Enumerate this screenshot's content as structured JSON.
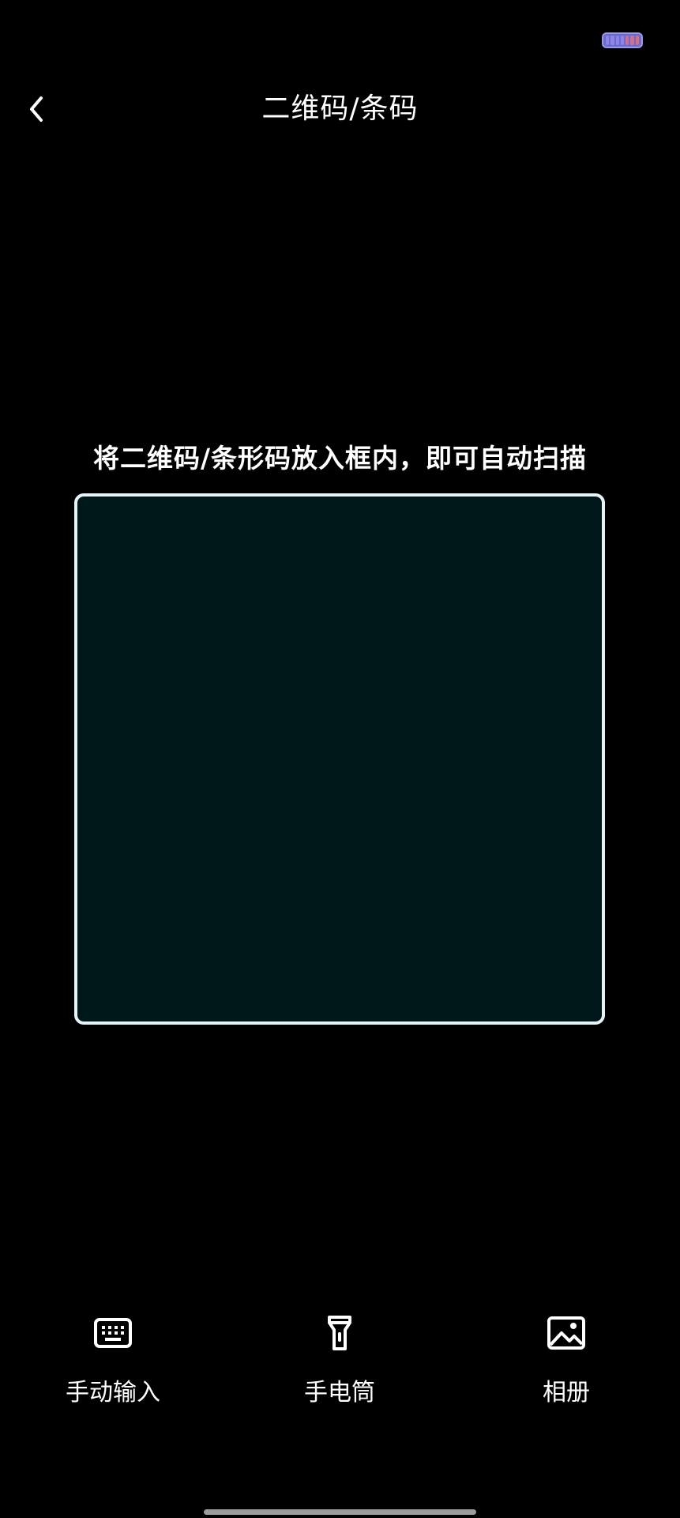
{
  "status_bar": {
    "indicator_icon": "status-indicator-icon"
  },
  "nav": {
    "back_icon": "chevron-left-icon",
    "title": "二维码/条码"
  },
  "scanner": {
    "hint": "将二维码/条形码放入框内，即可自动扫描",
    "frame_border_color": "#e4f4f8",
    "frame_fill_color": "#00171a"
  },
  "toolbar": {
    "items": [
      {
        "icon": "keyboard-icon",
        "label": "手动输入"
      },
      {
        "icon": "flashlight-icon",
        "label": "手电筒"
      },
      {
        "icon": "image-icon",
        "label": "相册"
      }
    ]
  },
  "colors": {
    "background": "#000000",
    "text": "#ffffff"
  }
}
